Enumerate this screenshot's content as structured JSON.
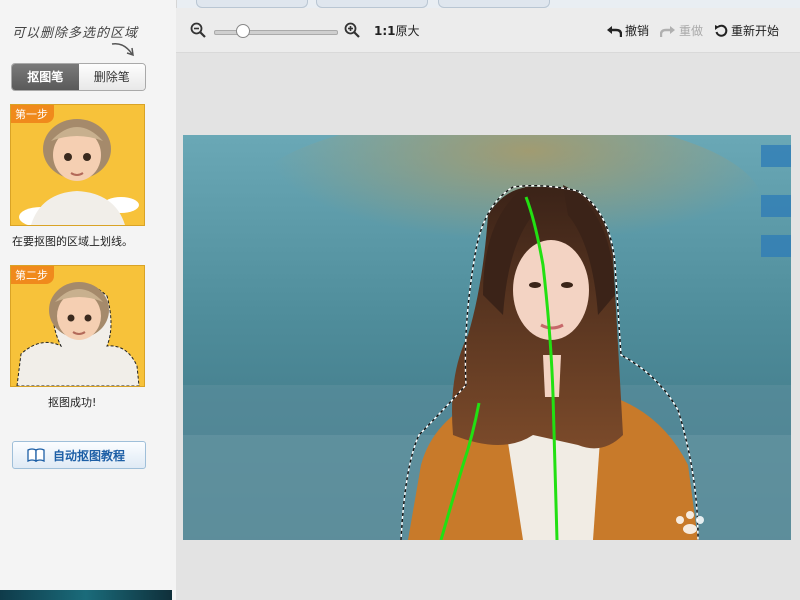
{
  "sidebar": {
    "hint": "可以删除多选的区域",
    "modes": [
      {
        "label": "抠图笔",
        "active": true
      },
      {
        "label": "删除笔",
        "active": false
      }
    ],
    "steps": [
      {
        "flag": "第一步",
        "caption": "在要抠图的区域上划线。"
      },
      {
        "flag": "第二步",
        "caption": "抠图成功!"
      }
    ],
    "tutorial_button": "自动抠图教程"
  },
  "toolbar": {
    "zoom_level": 0.23,
    "ratio_prefix": "1:1",
    "ratio_label": "原大",
    "undo": "撤销",
    "redo": "重做",
    "restart": "重新开始"
  },
  "colors": {
    "accent": "#1d5fa6",
    "stroke_line": "#22e012",
    "step_bg": "#f7c23a",
    "step_flag": "#f08a1c"
  }
}
